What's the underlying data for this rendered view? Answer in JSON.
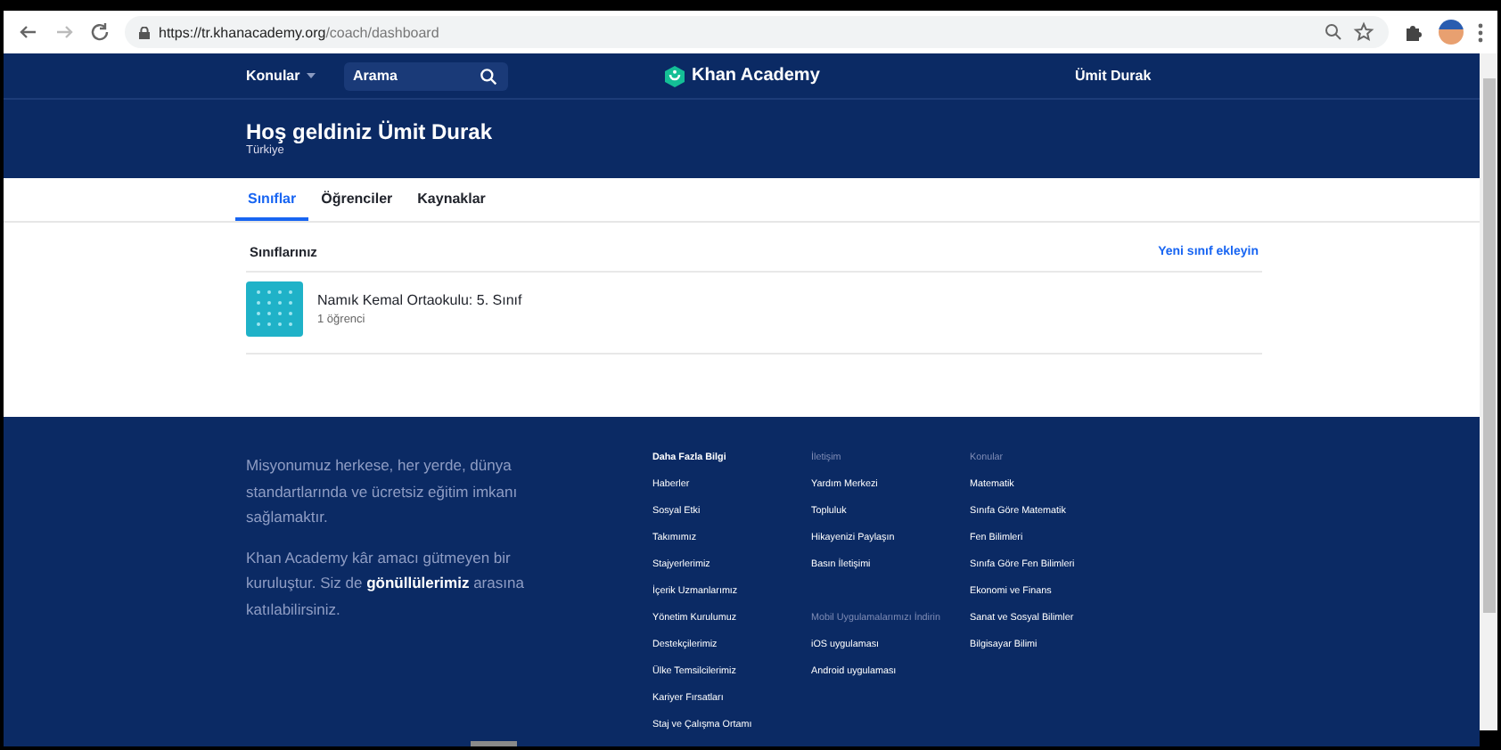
{
  "browser": {
    "url_host": "https://tr.khanacademy.org",
    "url_path": "/coach/dashboard"
  },
  "nav": {
    "menu": "Konular",
    "search_placeholder": "Arama",
    "logo": "Khan Academy",
    "user": "Ümit Durak"
  },
  "header": {
    "title": "Hoş geldiniz Ümit Durak",
    "subtitle": "Türkiye"
  },
  "tabs": [
    {
      "label": "Sınıflar",
      "selected": true
    },
    {
      "label": "Öğrenciler",
      "selected": false
    },
    {
      "label": "Kaynaklar",
      "selected": false
    }
  ],
  "classes": {
    "heading": "Sınıflarınız",
    "add_link": "Yeni sınıf ekleyin",
    "items": [
      {
        "name": "Namık Kemal Ortaokulu: 5. Sınıf",
        "count": "1 öğrenci"
      }
    ]
  },
  "footer": {
    "mission": "Misyonumuz herkese, her yerde, dünya standartlarında ve ücretsiz eğitim imkanı sağlamaktır.",
    "p2_before": "Khan Academy kâr amacı gütmeyen bir kuruluştur. Siz de",
    "p2_link": "gönüllülerimiz",
    "p2_after": "arasına katılabilirsiniz.",
    "columns": [
      {
        "items": [
          {
            "kind": "title",
            "text": "Daha Fazla Bilgi"
          },
          {
            "kind": "link",
            "text": "Haberler"
          },
          {
            "kind": "link",
            "text": "Sosyal Etki"
          },
          {
            "kind": "link",
            "text": "Takımımız"
          },
          {
            "kind": "link",
            "text": "Stajyerlerimiz"
          },
          {
            "kind": "link",
            "text": "İçerik Uzmanlarımız"
          },
          {
            "kind": "link",
            "text": "Yönetim Kurulumuz"
          },
          {
            "kind": "link",
            "text": "Destekçilerimiz"
          },
          {
            "kind": "link",
            "text": "Ülke Temsilcilerimiz"
          },
          {
            "kind": "link",
            "text": "Kariyer Fırsatları"
          },
          {
            "kind": "link",
            "text": "Staj ve Çalışma Ortamı"
          }
        ]
      },
      {
        "items": [
          {
            "kind": "heading",
            "text": "İletişim"
          },
          {
            "kind": "link",
            "text": "Yardım Merkezi"
          },
          {
            "kind": "link",
            "text": "Topluluk"
          },
          {
            "kind": "link",
            "text": "Hikayenizi Paylaşın"
          },
          {
            "kind": "link",
            "text": "Basın İletişimi"
          },
          {
            "kind": "spacer"
          },
          {
            "kind": "heading",
            "text": "Mobil Uygulamalarımızı İndirin"
          },
          {
            "kind": "link",
            "text": "iOS uygulaması"
          },
          {
            "kind": "link",
            "text": "Android uygulaması"
          }
        ]
      },
      {
        "items": [
          {
            "kind": "heading",
            "text": "Konular"
          },
          {
            "kind": "link",
            "text": "Matematik"
          },
          {
            "kind": "link",
            "text": "Sınıfa Göre Matematik"
          },
          {
            "kind": "link",
            "text": "Fen Bilimleri"
          },
          {
            "kind": "link",
            "text": "Sınıfa Göre Fen Bilimleri"
          },
          {
            "kind": "link",
            "text": "Ekonomi ve Finans"
          },
          {
            "kind": "link",
            "text": "Sanat ve Sosyal Bilimler"
          },
          {
            "kind": "link",
            "text": "Bilgisayar Bilimi"
          }
        ]
      }
    ]
  }
}
